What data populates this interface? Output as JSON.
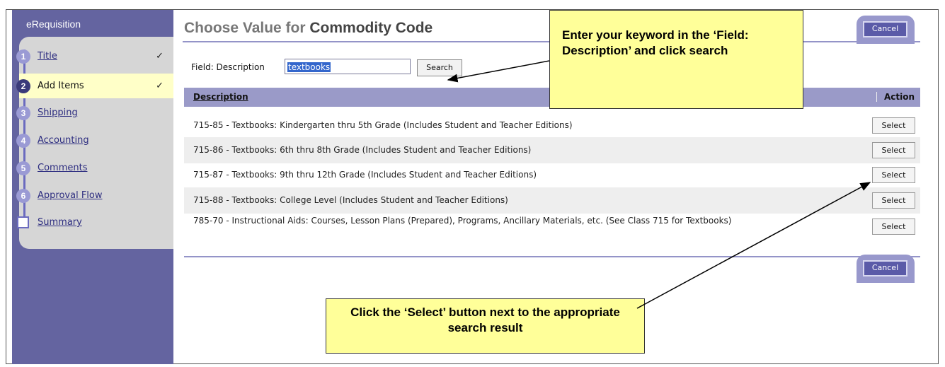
{
  "sidebar": {
    "app_title": "eRequisition",
    "steps": [
      {
        "num": "1",
        "label": "Title",
        "checked": true,
        "check": "✓"
      },
      {
        "num": "2",
        "label": "Add Items",
        "checked": true,
        "check": "✓"
      },
      {
        "num": "3",
        "label": "Shipping"
      },
      {
        "num": "4",
        "label": "Accounting"
      },
      {
        "num": "5",
        "label": "Comments"
      },
      {
        "num": "6",
        "label": "Approval Flow"
      },
      {
        "label": "Summary"
      }
    ]
  },
  "main": {
    "title_prefix": "Choose Value for",
    "title_field": "Commodity Code",
    "cancel_label": "Cancel",
    "search": {
      "field_label": "Field: Description",
      "value": "textbooks",
      "button_label": "Search"
    },
    "table": {
      "headers": {
        "description": "Description",
        "action": "Action"
      },
      "select_label": "Select",
      "rows": [
        "715-85 - Textbooks: Kindergarten thru 5th Grade (Includes Student and Teacher Editions)",
        "715-86 - Textbooks: 6th thru 8th Grade (Includes Student and Teacher Editions)",
        "715-87 - Textbooks: 9th thru 12th Grade (Includes Student and Teacher Editions)",
        "715-88 - Textbooks: College Level (Includes Student and Teacher Editions)",
        "785-70 - Instructional Aids: Courses, Lesson Plans (Prepared), Programs, Ancillary Materials, etc. (See Class 715 for Textbooks)"
      ]
    }
  },
  "callouts": {
    "top": "Enter your keyword in the ‘Field: Description’ and click search",
    "bottom": "Click the ‘Select’ button next to the appropriate search result"
  },
  "colors": {
    "sidebar": "#6464a0",
    "header_bar": "#9a9ac8",
    "callout": "#ffff99",
    "cancel_button": "#5b5ba8"
  }
}
